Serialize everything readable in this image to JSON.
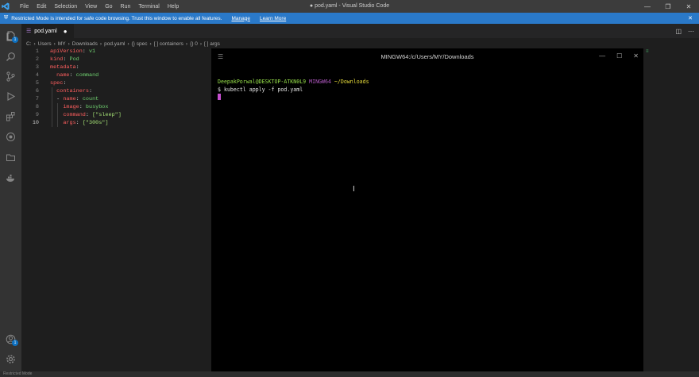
{
  "titlebar": {
    "menu": [
      "File",
      "Edit",
      "Selection",
      "View",
      "Go",
      "Run",
      "Terminal",
      "Help"
    ],
    "window_title": "● pod.yaml - Visual Studio Code"
  },
  "notice": {
    "text": "Restricted Mode is intended for safe code browsing. Trust this window to enable all features.",
    "manage": "Manage",
    "learn_more": "Learn More"
  },
  "tab": {
    "name": "pod.yaml",
    "dirty": "●"
  },
  "breadcrumb": [
    "C:",
    "Users",
    "MY",
    "Downloads",
    "pod.yaml",
    "{} spec",
    "[ ] containers",
    "{} 0",
    "[ ] args"
  ],
  "editor": {
    "lines": [
      {
        "n": "1",
        "key": "apiVersion",
        "val": "v1",
        "indent": ""
      },
      {
        "n": "2",
        "key": "kind",
        "val": "Pod",
        "indent": ""
      },
      {
        "n": "3",
        "key": "metadata",
        "val": "",
        "indent": ""
      },
      {
        "n": "4",
        "key": "name",
        "val": "command",
        "indent": "  "
      },
      {
        "n": "5",
        "key": "spec",
        "val": "",
        "indent": ""
      },
      {
        "n": "6",
        "key": "containers",
        "val": "",
        "indent": "  "
      },
      {
        "n": "7",
        "key": "name",
        "val": "count",
        "indent": "  - "
      },
      {
        "n": "8",
        "key": "image",
        "val": "busybox",
        "indent": "    "
      },
      {
        "n": "9",
        "key": "command",
        "val": "[\"sleep\"]",
        "indent": "    "
      },
      {
        "n": "10",
        "key": "args",
        "val": "[\"300s\"]",
        "indent": "    "
      }
    ]
  },
  "terminal": {
    "title": "MINGW64:/c/Users/MY/Downloads",
    "user_host": "DeepakPorwal@DESKTOP-ATKN0L9",
    "shell": "MINGW64",
    "path": "~/Downloads",
    "prompt": "$",
    "command": "kubectl apply -f pod.yaml"
  },
  "statusbar": {
    "restricted": "Restricted Mode"
  }
}
